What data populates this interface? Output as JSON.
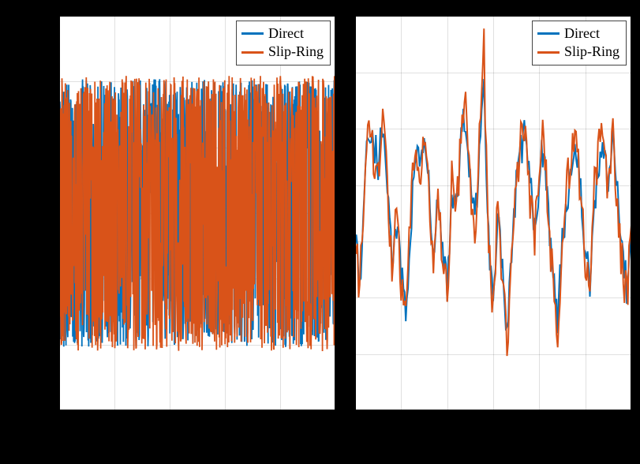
{
  "legend_left": {
    "item1": "Direct",
    "item2": "Slip-Ring"
  },
  "legend_right": {
    "item1": "Direct",
    "item2": "Slip-Ring"
  },
  "colors": {
    "direct": "#0072BD",
    "slipring": "#D95319"
  },
  "chart_data": [
    {
      "type": "line",
      "title": "",
      "xlabel": "",
      "ylabel": "",
      "xlim": [
        0,
        10
      ],
      "ylim": [
        -1.0,
        1.0
      ],
      "grid": true,
      "legend_position": "top-right",
      "series": [
        {
          "name": "Direct",
          "note": "dense noisy signal occupying roughly ±0.65 band with excursions to ±0.95",
          "approx_envelope": [
            -0.95,
            0.95
          ],
          "approx_rms_band": [
            -0.65,
            0.65
          ]
        },
        {
          "name": "Slip-Ring",
          "note": "dense noisy signal closely tracking Direct, same band",
          "approx_envelope": [
            -0.95,
            0.95
          ],
          "approx_rms_band": [
            -0.65,
            0.65
          ]
        }
      ]
    },
    {
      "type": "line",
      "title": "",
      "xlabel": "",
      "ylabel": "",
      "xlim": [
        0,
        1.2
      ],
      "ylim": [
        -0.8,
        0.8
      ],
      "grid": true,
      "legend_position": "top-right",
      "series": [
        {
          "name": "Direct",
          "x": [
            0.0,
            0.02,
            0.04,
            0.06,
            0.08,
            0.1,
            0.12,
            0.14,
            0.16,
            0.18,
            0.2,
            0.22,
            0.24,
            0.26,
            0.28,
            0.3,
            0.32,
            0.34,
            0.36,
            0.38,
            0.4,
            0.42,
            0.44,
            0.46,
            0.48,
            0.5,
            0.52,
            0.54,
            0.56,
            0.58,
            0.6,
            0.62,
            0.64,
            0.66,
            0.68,
            0.7,
            0.72,
            0.74,
            0.76,
            0.78,
            0.8,
            0.82,
            0.84,
            0.86,
            0.88,
            0.9,
            0.92,
            0.94,
            0.96,
            0.98,
            1.0,
            1.02,
            1.04,
            1.06,
            1.08,
            1.1,
            1.12,
            1.14,
            1.16,
            1.18,
            1.2
          ],
          "values": [
            -0.05,
            -0.3,
            0.1,
            0.35,
            0.3,
            0.2,
            0.35,
            0.15,
            -0.2,
            -0.05,
            -0.25,
            -0.4,
            -0.1,
            0.25,
            0.2,
            0.3,
            0.1,
            -0.2,
            0.05,
            -0.15,
            -0.3,
            0.1,
            0.0,
            0.3,
            0.4,
            0.15,
            -0.05,
            0.25,
            0.5,
            -0.1,
            -0.35,
            0.05,
            -0.25,
            -0.5,
            -0.2,
            0.1,
            0.25,
            0.35,
            0.1,
            -0.05,
            0.15,
            0.3,
            0.0,
            -0.25,
            -0.45,
            -0.1,
            0.05,
            0.2,
            0.3,
            0.1,
            -0.15,
            -0.3,
            0.05,
            0.2,
            0.3,
            0.1,
            0.35,
            0.05,
            -0.15,
            -0.3,
            -0.1
          ]
        },
        {
          "name": "Slip-Ring",
          "x": [
            0.0,
            0.02,
            0.04,
            0.06,
            0.08,
            0.1,
            0.12,
            0.14,
            0.16,
            0.18,
            0.2,
            0.22,
            0.24,
            0.26,
            0.28,
            0.3,
            0.32,
            0.34,
            0.36,
            0.38,
            0.4,
            0.42,
            0.44,
            0.46,
            0.48,
            0.5,
            0.52,
            0.54,
            0.56,
            0.58,
            0.6,
            0.62,
            0.64,
            0.66,
            0.68,
            0.7,
            0.72,
            0.74,
            0.76,
            0.78,
            0.8,
            0.82,
            0.84,
            0.86,
            0.88,
            0.9,
            0.92,
            0.94,
            0.96,
            0.98,
            1.0,
            1.02,
            1.04,
            1.06,
            1.08,
            1.1,
            1.12,
            1.14,
            1.16,
            1.18,
            1.2
          ],
          "values": [
            -0.02,
            -0.35,
            0.15,
            0.38,
            0.25,
            0.15,
            0.4,
            0.1,
            -0.25,
            -0.02,
            -0.3,
            -0.45,
            -0.05,
            0.3,
            0.15,
            0.35,
            0.05,
            -0.25,
            0.1,
            -0.2,
            -0.35,
            0.15,
            -0.05,
            0.35,
            0.45,
            0.1,
            -0.1,
            0.3,
            0.65,
            -0.15,
            -0.4,
            0.1,
            -0.3,
            -0.55,
            -0.15,
            0.15,
            0.3,
            0.4,
            0.05,
            -0.1,
            0.2,
            0.35,
            -0.05,
            -0.3,
            -0.5,
            -0.05,
            0.1,
            0.25,
            0.35,
            0.05,
            -0.2,
            -0.35,
            0.1,
            0.25,
            0.35,
            0.05,
            0.4,
            0.0,
            -0.2,
            -0.35,
            -0.05
          ]
        }
      ]
    }
  ]
}
